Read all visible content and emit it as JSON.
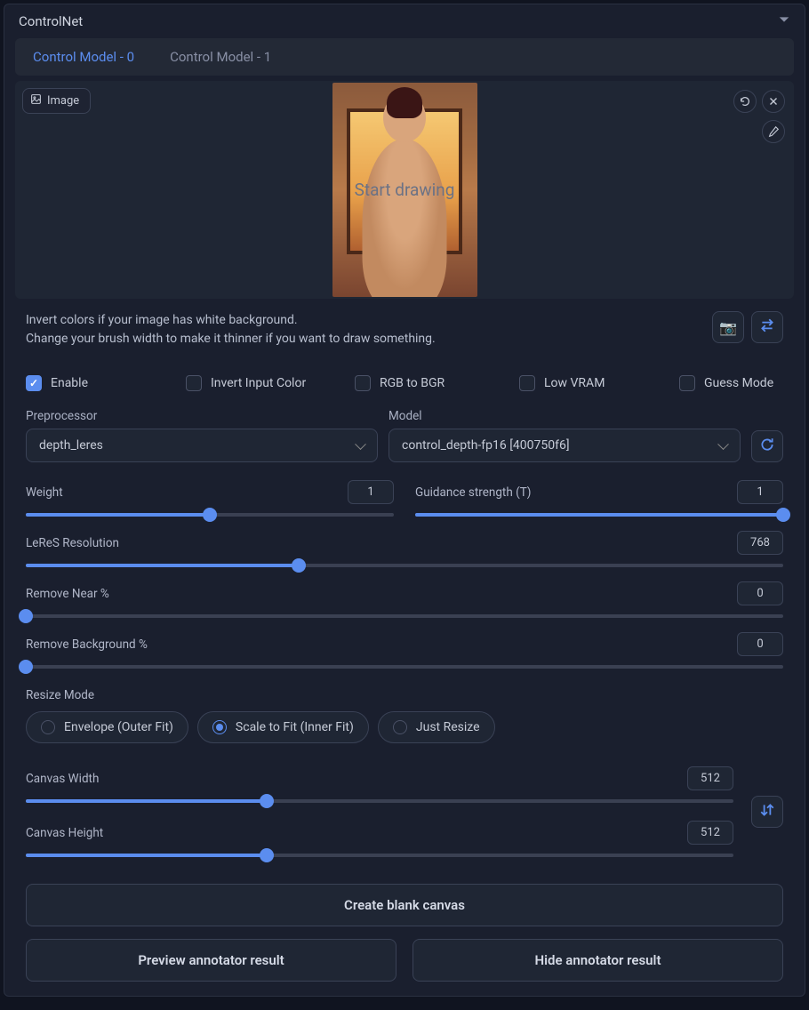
{
  "panel": {
    "title": "ControlNet"
  },
  "tabs": [
    {
      "label": "Control Model - 0",
      "active": true
    },
    {
      "label": "Control Model - 1",
      "active": false
    }
  ],
  "image": {
    "badge": "Image",
    "overlay": "Start drawing"
  },
  "hints": {
    "line1": "Invert colors if your image has white background.",
    "line2": "Change your brush width to make it thinner if you want to draw something."
  },
  "options": {
    "enable": {
      "label": "Enable",
      "checked": true
    },
    "invert": {
      "label": "Invert Input Color",
      "checked": false
    },
    "rgb": {
      "label": "RGB to BGR",
      "checked": false
    },
    "lowvram": {
      "label": "Low VRAM",
      "checked": false
    },
    "guess": {
      "label": "Guess Mode",
      "checked": false
    }
  },
  "selects": {
    "preproc_label": "Preprocessor",
    "preproc_value": "depth_leres",
    "model_label": "Model",
    "model_value": "control_depth-fp16 [400750f6]"
  },
  "sliders": {
    "weight": {
      "label": "Weight",
      "value": "1",
      "pct": 50
    },
    "guidance": {
      "label": "Guidance strength (T)",
      "value": "1",
      "pct": 100
    },
    "leres": {
      "label": "LeReS Resolution",
      "value": "768",
      "pct": 36
    },
    "near": {
      "label": "Remove Near %",
      "value": "0",
      "pct": 0
    },
    "bg": {
      "label": "Remove Background %",
      "value": "0",
      "pct": 0
    },
    "cw": {
      "label": "Canvas Width",
      "value": "512",
      "pct": 34
    },
    "ch": {
      "label": "Canvas Height",
      "value": "512",
      "pct": 34
    }
  },
  "resize": {
    "label": "Resize Mode",
    "options": [
      {
        "label": "Envelope (Outer Fit)",
        "checked": false
      },
      {
        "label": "Scale to Fit (Inner Fit)",
        "checked": true
      },
      {
        "label": "Just Resize",
        "checked": false
      }
    ]
  },
  "buttons": {
    "blank": "Create blank canvas",
    "preview": "Preview annotator result",
    "hide": "Hide annotator result"
  }
}
